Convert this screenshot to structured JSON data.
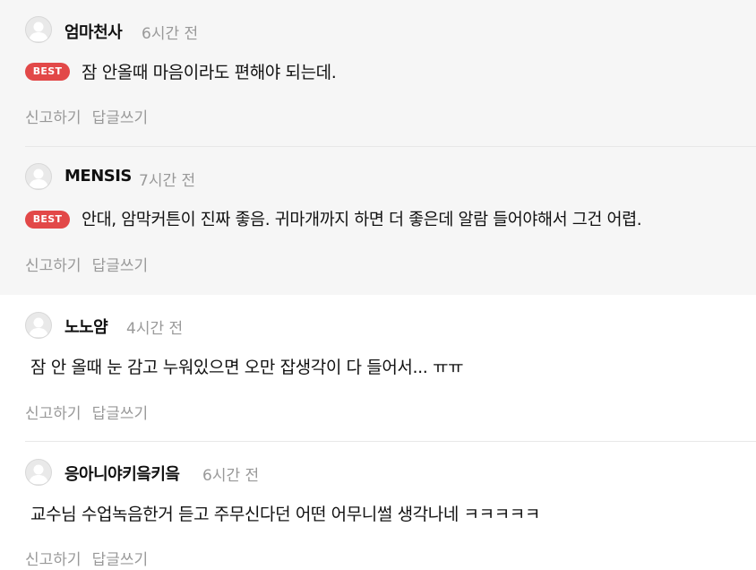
{
  "comments": [
    {
      "nickname": "엄마천사",
      "time": "6시간 전",
      "best": true,
      "best_label": "BEST",
      "text": "잠 안올때 마음이라도 편해야 되는데.",
      "report_label": "신고하기",
      "reply_label": "답글쓰기"
    },
    {
      "nickname": "MENSIS",
      "time": "7시간 전",
      "best": true,
      "best_label": "BEST",
      "text": "안대, 암막커튼이 진짜 좋음. 귀마개까지 하면 더 좋은데 알람 들어야해서 그건 어렵.",
      "report_label": "신고하기",
      "reply_label": "답글쓰기"
    },
    {
      "nickname": "노노얌",
      "time": "4시간 전",
      "best": false,
      "text": "잠 안 올때 눈 감고 누워있으면 오만 잡생각이 다 들어서... ㅠㅠ",
      "report_label": "신고하기",
      "reply_label": "답글쓰기"
    },
    {
      "nickname": "응아니야키읔키읔",
      "time": "6시간 전",
      "best": false,
      "text": "교수님 수업녹음한거 듣고 주무신다던 어떤 어무니썰 생각나네 ㅋㅋㅋㅋㅋ",
      "report_label": "신고하기",
      "reply_label": "답글쓰기"
    }
  ],
  "colors": {
    "best_badge": "#e24848",
    "best_background": "#f6f6f6",
    "muted_text": "#999999"
  },
  "icons": {
    "avatar": "default-user-avatar-icon"
  }
}
